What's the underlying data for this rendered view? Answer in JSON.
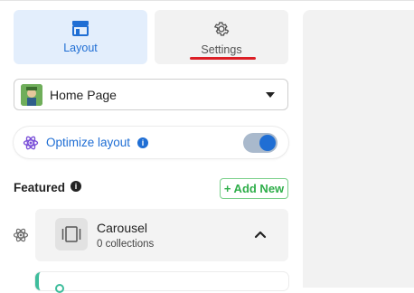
{
  "tabs": [
    {
      "label": "Layout",
      "icon": "store-icon",
      "active": true
    },
    {
      "label": "Settings",
      "icon": "gear-icon",
      "active": false
    }
  ],
  "page_selector": {
    "value": "Home Page",
    "icon": "chevron-down-icon"
  },
  "optimize": {
    "label": "Optimize layout",
    "enabled": true
  },
  "featured": {
    "label": "Featured",
    "add_label": "+ Add New"
  },
  "sections": [
    {
      "title": "Carousel",
      "subtitle": "0 collections",
      "expanded": true
    }
  ],
  "colors": {
    "accent": "#1f6ed4",
    "active_tab_bg": "#e3eefc",
    "settings_underline": "#dc1f26",
    "add_new": "#2fae4a",
    "next_section_accent": "#3ebd9c"
  }
}
